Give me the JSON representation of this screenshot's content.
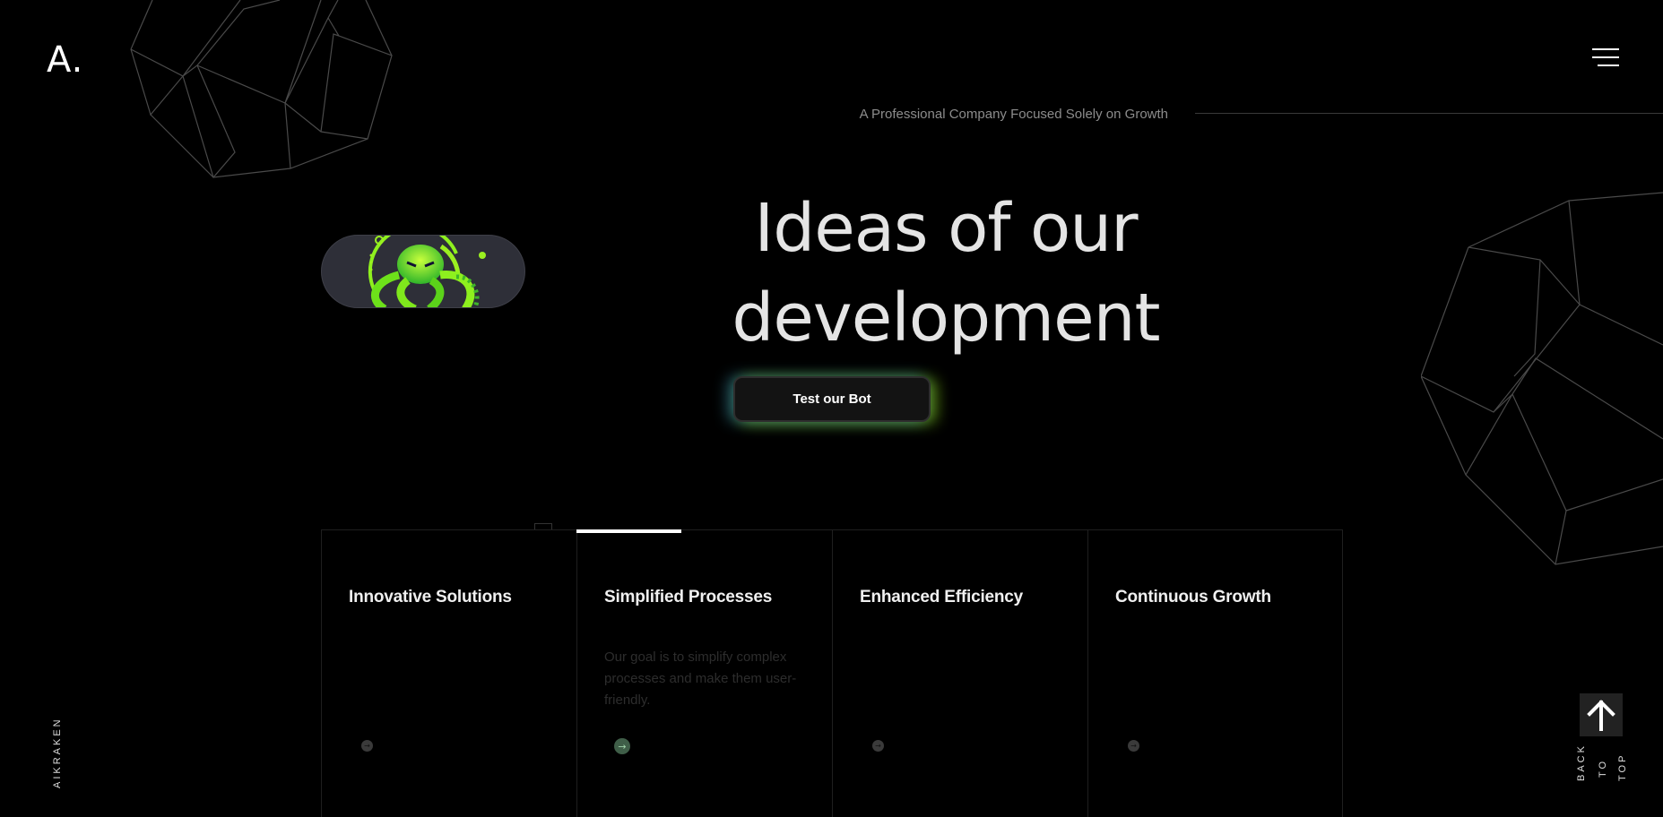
{
  "header": {
    "logo": "A.",
    "menu_icon": "hamburger-icon"
  },
  "hero": {
    "tagline": "A Professional Company Focused Solely on Growth",
    "title_line1": "Ideas of our",
    "title_line2": "development",
    "cta_label": "Test our Bot",
    "mascot_icon": "octopus-mascot-icon"
  },
  "cards": [
    {
      "title": "Innovative Solutions",
      "description": ""
    },
    {
      "title": "Simplified Processes",
      "description": "Our goal is to simplify complex processes and make them user-friendly."
    },
    {
      "title": "Enhanced Efficiency",
      "description": ""
    },
    {
      "title": "Continuous Growth",
      "description": ""
    }
  ],
  "active_card_index": 1,
  "side": {
    "brand": "AIKRAKEN",
    "back_to_top_words": [
      "BACK",
      "TO",
      "TOP"
    ],
    "back_to_top_icon": "arrow-up-icon"
  },
  "colors": {
    "background": "#000000",
    "glow_cyan": "#50c8e6",
    "glow_lime": "#96e61e",
    "mascot_green": "#8ef01e"
  }
}
